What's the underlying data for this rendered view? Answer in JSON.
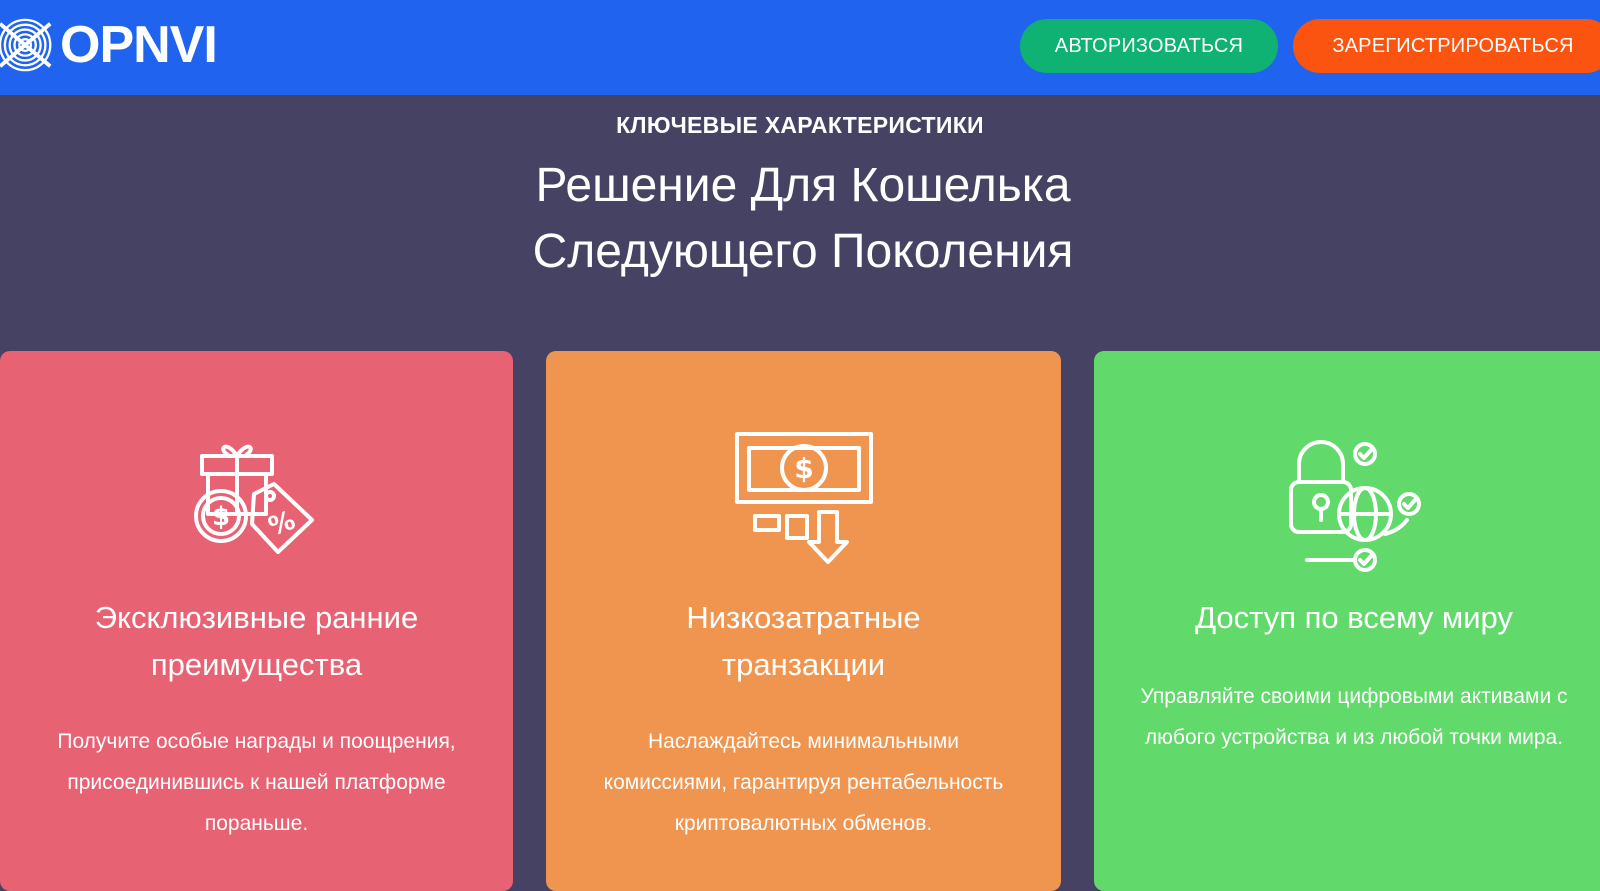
{
  "header": {
    "logo_text": "OPNVI",
    "logo_icon": "concentric-circles-icon",
    "login_label": "АВТОРИЗОВАТЬСЯ",
    "register_label": "ЗАРЕГИСТРИРОВАТЬСЯ"
  },
  "hero": {
    "eyebrow": "КЛЮЧЕВЫЕ ХАРАКТЕРИСТИКИ",
    "title_line1": "Решение Для Кошелька",
    "title_line2": "Следующего Поколения"
  },
  "features": [
    {
      "icon": "gift-discount-icon",
      "title": "Эксклюзивные ранние преимущества",
      "text": "Получите особые награды и поощрения, присоединившись к нашей платформе пораньше."
    },
    {
      "icon": "banknote-down-icon",
      "title": "Низкозатратные транзакции",
      "text": "Наслаждайтесь минимальными комиссиями, гарантируя рентабельность криптовалютных обменов."
    },
    {
      "icon": "global-lock-icon",
      "title": "Доступ по всему миру",
      "text": "Управляйте своими цифровыми активами с любого устройства и из любой точки мира."
    }
  ],
  "colors": {
    "topbar": "#1f63ee",
    "background": "#454263",
    "login_button": "#10b273",
    "register_button": "#fb5410",
    "card_1": "#e76272",
    "card_2": "#f09550",
    "card_3": "#62d96b"
  }
}
